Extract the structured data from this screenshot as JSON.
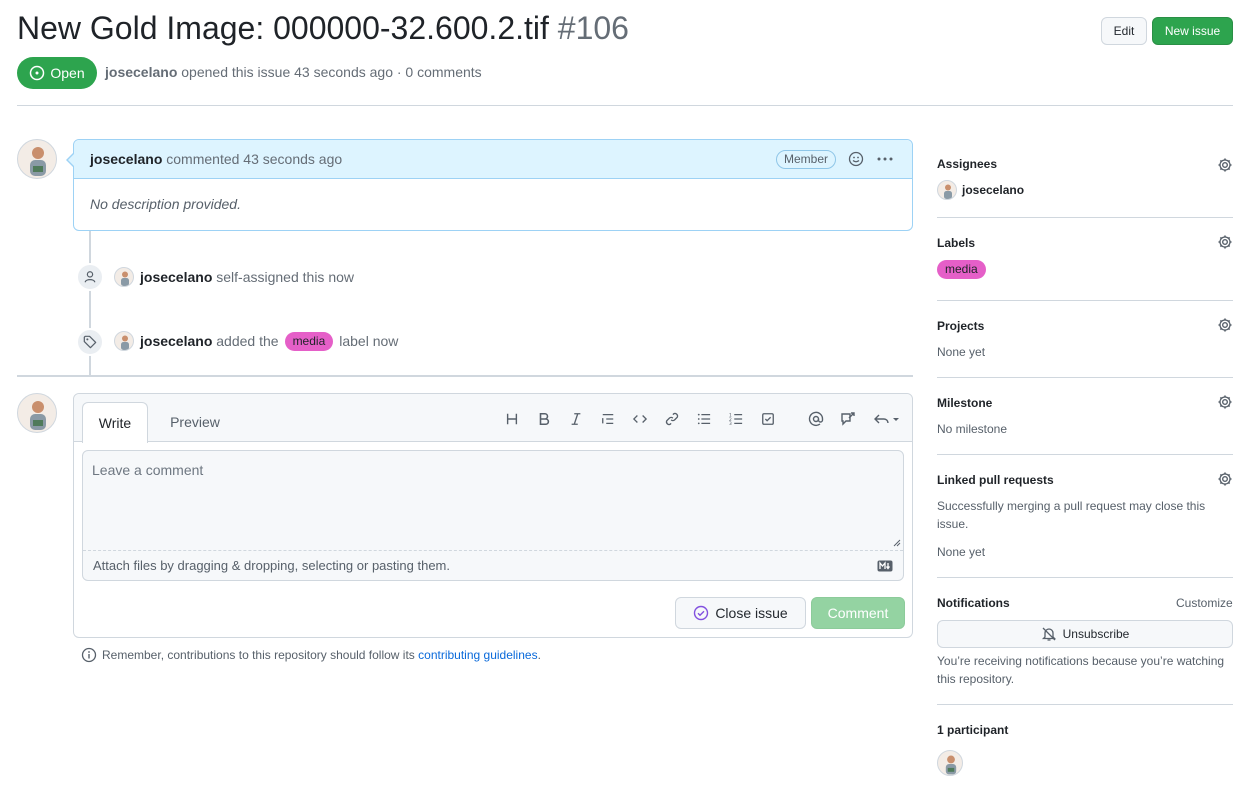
{
  "issue": {
    "title": "New Gold Image: 000000-32.600.2.tif",
    "number": "#106",
    "state": "Open",
    "author": "josecelano",
    "opened_text": "opened this issue 43 seconds ago · 0 comments"
  },
  "header_buttons": {
    "edit": "Edit",
    "new_issue": "New issue"
  },
  "comment": {
    "author": "josecelano",
    "action": "commented 43 seconds ago",
    "badge": "Member",
    "body": "No description provided."
  },
  "timeline": [
    {
      "user": "josecelano",
      "text": "self-assigned this now",
      "icon": "person-icon"
    },
    {
      "user": "josecelano",
      "pre": "added the",
      "label": "media",
      "post": "label now",
      "icon": "tag-icon"
    }
  ],
  "compose": {
    "tabs": [
      "Write",
      "Preview"
    ],
    "placeholder": "Leave a comment",
    "attach": "Attach files by dragging & dropping, selecting or pasting them.",
    "close_button": "Close issue",
    "comment_button": "Comment"
  },
  "remember": {
    "text": "Remember, contributions to this repository should follow its",
    "link": "contributing guidelines",
    "tail": "."
  },
  "sidebar": {
    "assignees": {
      "heading": "Assignees",
      "user": "josecelano"
    },
    "labels": {
      "heading": "Labels",
      "label": "media",
      "label_color": "#e55fc8"
    },
    "projects": {
      "heading": "Projects",
      "value": "None yet"
    },
    "milestone": {
      "heading": "Milestone",
      "value": "No milestone"
    },
    "linked_prs": {
      "heading": "Linked pull requests",
      "desc": "Successfully merging a pull request may close this issue.",
      "value": "None yet"
    },
    "notifications": {
      "heading": "Notifications",
      "customize": "Customize",
      "button": "Unsubscribe",
      "desc": "You’re receiving notifications because you’re watching this repository."
    },
    "participants": {
      "heading": "1 participant"
    }
  },
  "colors": {
    "open_green": "#2da44e",
    "link_blue": "#0969da",
    "comment_header": "#ddf4ff"
  }
}
